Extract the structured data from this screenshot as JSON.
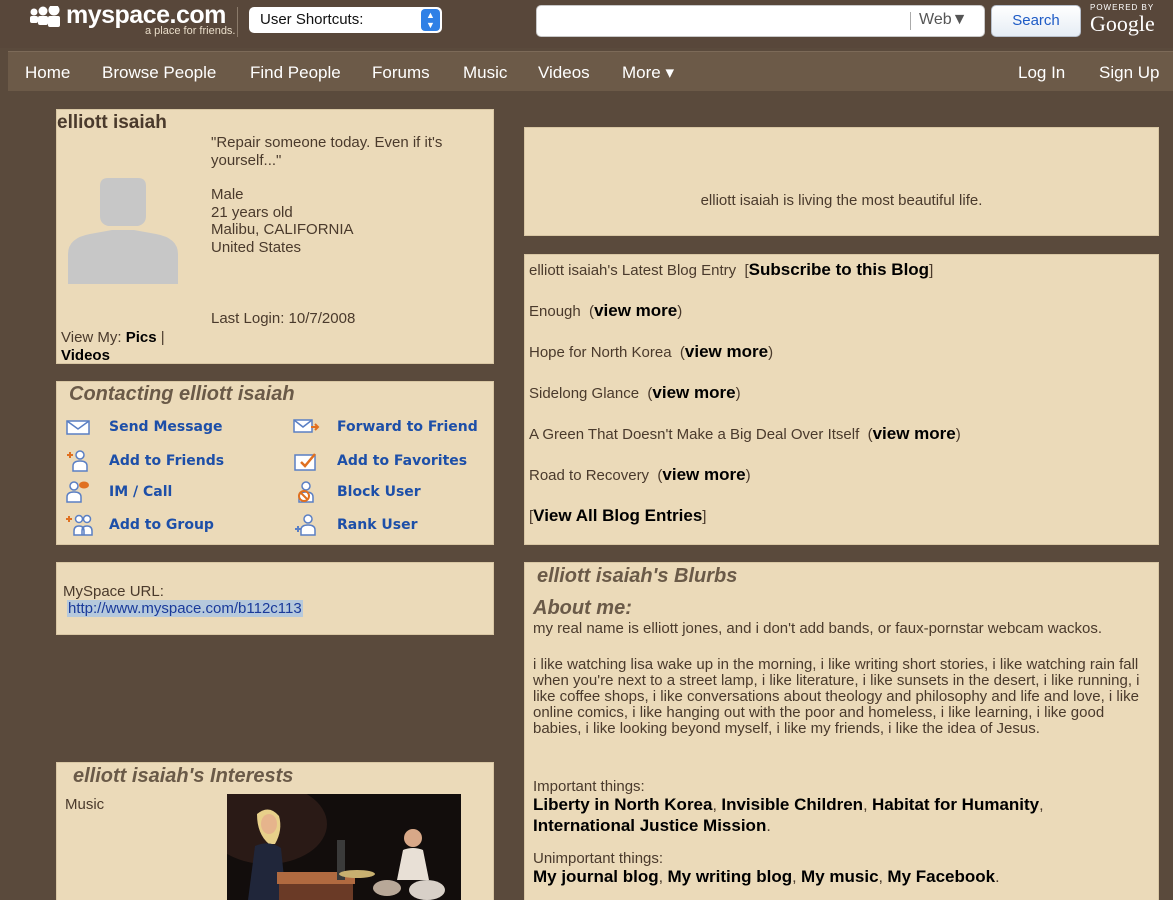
{
  "header": {
    "logo_text": "myspace.com",
    "logo_tagline": "a place for friends.",
    "shortcuts_label": "User Shortcuts:",
    "search_value": "",
    "search_scope": "Web▼",
    "search_button": "Search",
    "powered_by": "POWERED BY",
    "google": "Google"
  },
  "nav": {
    "items": [
      "Home",
      "Browse People",
      "Find People",
      "Forums",
      "Music",
      "Videos",
      "More ▾"
    ],
    "login": "Log In",
    "signup": "Sign Up"
  },
  "profile": {
    "name": "elliott isaiah",
    "quote": "\"Repair someone today. Even if it's yourself...\"",
    "gender": "Male",
    "age": "21 years old",
    "city": "Malibu, CALIFORNIA",
    "country": "United States",
    "last_login": "Last Login: 10/7/2008",
    "view_my": "View My:",
    "pics": "Pics",
    "pipe": "|",
    "videos": "Videos"
  },
  "contact": {
    "title": "Contacting elliott isaiah",
    "items": [
      {
        "label": "Send Message",
        "icon": "envelope-icon"
      },
      {
        "label": "Forward to Friend",
        "icon": "forward-icon"
      },
      {
        "label": "Add to Friends",
        "icon": "add-friend-icon"
      },
      {
        "label": "Add to Favorites",
        "icon": "favorites-icon"
      },
      {
        "label": "IM / Call",
        "icon": "im-icon"
      },
      {
        "label": "Block User",
        "icon": "block-icon"
      },
      {
        "label": "Add to Group",
        "icon": "add-group-icon"
      },
      {
        "label": "Rank User",
        "icon": "rank-icon"
      }
    ]
  },
  "url_box": {
    "label": "MySpace URL:",
    "url": "http://www.myspace.com/b112c113"
  },
  "status": {
    "text": "elliott isaiah is living the most beautiful life."
  },
  "blog": {
    "heading_prefix": "elliott isaiah's Latest Blog Entry",
    "subscribe": "Subscribe to this Blog",
    "view_more": "view more",
    "entries": [
      "Enough",
      "Hope for North Korea",
      "Sidelong Glance",
      "A Green That Doesn't Make a Big Deal Over Itself",
      "Road to Recovery"
    ],
    "view_all": "View All Blog Entries"
  },
  "blurbs": {
    "title": "elliott isaiah's Blurbs",
    "about_heading": "About me:",
    "about_p1": "my real name is elliott jones, and i don't add bands, or faux-pornstar webcam wackos.",
    "about_p2": "i like watching lisa wake up in the morning, i like writing short stories, i like watching rain fall when you're next to a street lamp, i like literature, i like sunsets in the desert, i like running, i like coffee shops, i like conversations about theology and philosophy and life and love, i like online comics, i like hanging out with the poor and homeless, i like learning, i like good babies, i like looking beyond myself, i like my friends, i like the idea of Jesus.",
    "important_label": "Important things:",
    "important_links": [
      "Liberty in North Korea",
      "Invisible Children",
      "Habitat for Humanity",
      "International Justice Mission"
    ],
    "unimportant_label": "Unimportant things:",
    "unimportant_links": [
      "My journal blog",
      "My writing blog",
      "My music",
      "My Facebook"
    ],
    "sep": ", ",
    "end": "."
  },
  "interests": {
    "title": "elliott isaiah's Interests",
    "music_label": "Music"
  },
  "colors": {
    "page_bg": "#5a4a3c",
    "panel_bg": "#ebdab9",
    "link_blue": "#1d4fa8"
  }
}
